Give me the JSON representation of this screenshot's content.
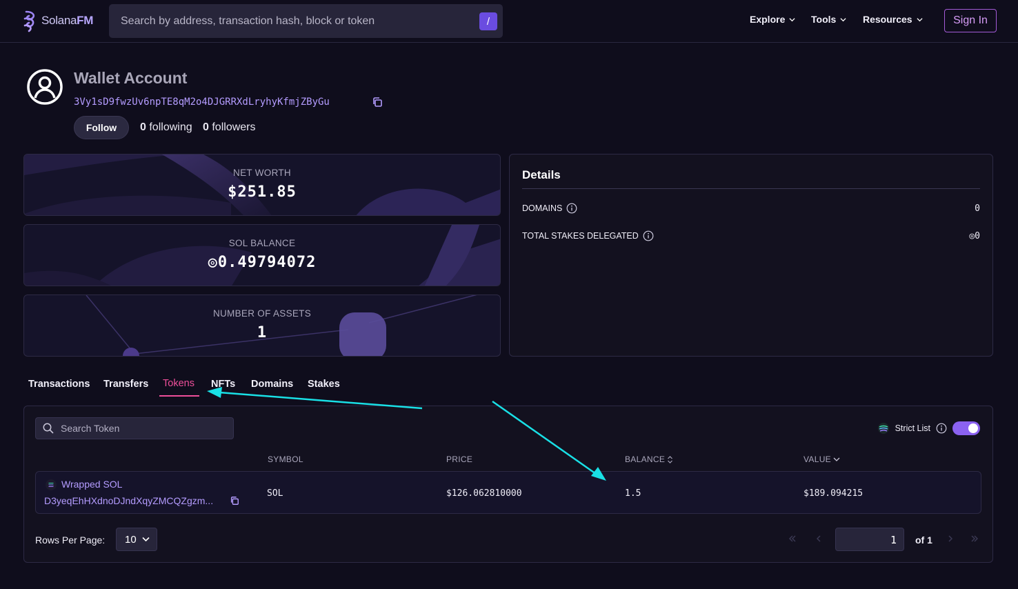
{
  "header": {
    "logo_prefix": "Solana",
    "logo_suffix": "FM",
    "search_placeholder": "Search by address, transaction hash, block or token",
    "search_shortcut": "/",
    "nav": [
      {
        "label": "Explore"
      },
      {
        "label": "Tools"
      },
      {
        "label": "Resources"
      }
    ],
    "sign_in_label": "Sign In"
  },
  "profile": {
    "title": "Wallet Account",
    "address": "3Vy1sD9fwzUv6npTE8qM2o4DJGRRXdLryhyKfmjZByGu",
    "follow_label": "Follow",
    "following_count": "0",
    "following_label": "following",
    "followers_count": "0",
    "followers_label": "followers"
  },
  "stats": {
    "net_worth_label": "NET WORTH",
    "net_worth_value": "$251.85",
    "sol_balance_label": "SOL BALANCE",
    "sol_balance_value": "◎0.49794072",
    "assets_label": "NUMBER OF ASSETS",
    "assets_value": "1"
  },
  "details": {
    "title": "Details",
    "rows": [
      {
        "label": "DOMAINS",
        "value": "0"
      },
      {
        "label": "TOTAL STAKES DELEGATED",
        "value": "◎0"
      }
    ]
  },
  "tabs": [
    {
      "label": "Transactions",
      "active": false
    },
    {
      "label": "Transfers",
      "active": false
    },
    {
      "label": "Tokens",
      "active": true
    },
    {
      "label": "NFTs",
      "active": false
    },
    {
      "label": "Domains",
      "active": false
    },
    {
      "label": "Stakes",
      "active": false
    }
  ],
  "tokens": {
    "search_placeholder": "Search Token",
    "strict_list_label": "Strict List",
    "strict_list_enabled": true,
    "columns": [
      "SYMBOL",
      "PRICE",
      "BALANCE",
      "VALUE"
    ],
    "rows": [
      {
        "name": "Wrapped SOL",
        "mint": "D3yeqEhHXdnoDJndXqyZMCQZgzm...",
        "symbol": "SOL",
        "price": "$126.062810000",
        "balance": "1.5",
        "value": "$189.094215"
      }
    ],
    "rows_per_page_label": "Rows Per Page:",
    "rows_per_page": "10",
    "current_page": "1",
    "of_pages": "of 1"
  },
  "colors": {
    "background": "#0f0d1c",
    "accent_purple": "#b49cff",
    "active_tab": "#ef4f9a",
    "annotation_arrow": "#19e0e6"
  }
}
